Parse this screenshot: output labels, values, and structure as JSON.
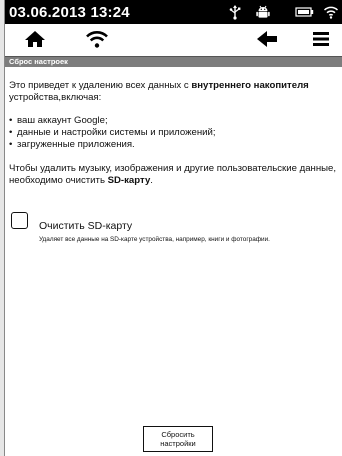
{
  "status_bar": {
    "time": "03.06.2013  13:24",
    "icons": [
      "usb-icon",
      "android-icon",
      "battery-icon",
      "wifi-icon"
    ]
  },
  "nav_bar": {
    "icons": [
      "home-icon",
      "wifi-icon",
      "back-icon",
      "menu-icon"
    ]
  },
  "section": {
    "title": "Сброс настроек"
  },
  "content": {
    "intro_before": "Это приведет к удалению всех данных с ",
    "intro_bold": "внутреннего накопителя",
    "intro_after": " устройства,включая:",
    "items": [
      "ваш аккаунт Google;",
      "данные и настройки системы и приложений;",
      "загруженные приложения."
    ],
    "note_before": "Чтобы удалить музыку, изображения и другие пользовательские данные, необходимо очистить ",
    "note_bold": "SD-карту",
    "note_after": "."
  },
  "sd_option": {
    "label": "Очистить SD-карту",
    "description": "Удаляет все данные на SD-карте устройства, например, книги и фотографии.",
    "checked": false
  },
  "reset_button": {
    "label": "Сбросить настройки"
  }
}
